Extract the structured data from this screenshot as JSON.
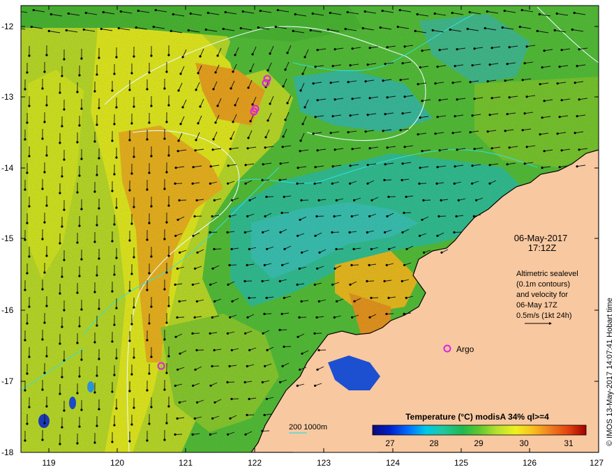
{
  "map": {
    "date": "06-May-2017",
    "time": "17:12Z",
    "altimetry_note": [
      "Altimetric sealevel",
      "(0.1m contours)",
      "and velocity for",
      "06-May 17Z",
      "0.5m/s (1kt 24h)"
    ],
    "argo_label": "Argo",
    "credit": "© IMOS 13-May-2017 14:07:41 Hobart time",
    "depth_legend": "200  1000m",
    "colorbar": {
      "title": "Temperature (°C) modisA 34% ql>=4",
      "ticks": [
        "27",
        "28",
        "29",
        "30",
        "31"
      ],
      "colors": [
        "#0a0a7a",
        "#0020c8",
        "#0070ff",
        "#00c8e6",
        "#20c8a0",
        "#20b850",
        "#60c830",
        "#b4e030",
        "#f0f020",
        "#f8c020",
        "#f08020",
        "#e04010",
        "#a00000"
      ]
    },
    "x_ticks": [
      "119",
      "120",
      "121",
      "122",
      "123",
      "124",
      "125",
      "126",
      "127"
    ],
    "y_ticks": [
      "-12",
      "-13",
      "-14",
      "-15",
      "-16",
      "-17",
      "-18"
    ],
    "colors": {
      "land": "#f8c8a0",
      "argo": "#e020e0",
      "contour": "#e8f8f8",
      "isobath": "#30e0e0"
    }
  }
}
